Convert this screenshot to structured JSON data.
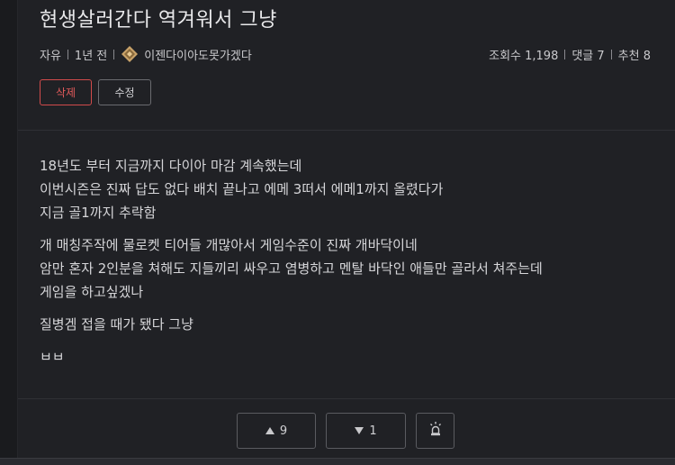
{
  "post": {
    "title": "현생살러간다 역겨워서 그냥",
    "category": "자유",
    "time": "1년 전",
    "author": "이젠다이아도못가겠다",
    "views": "조회수 1,198",
    "comments": "댓글 7",
    "recommends": "추천 8"
  },
  "actions": {
    "delete_label": "삭제",
    "edit_label": "수정"
  },
  "content": {
    "lines": [
      "18년도 부터 지금까지 다이아 마감 계속했는데",
      "이번시즌은 진짜 답도 없다 배치 끝나고 에메 3떠서 에메1까지 올렸다가",
      "지금 골1까지 추락함",
      "개 매칭주작에 물로켓 티어들 개많아서 게임수준이 진짜 개바닥이네",
      "암만 혼자 2인분을 쳐해도 지들끼리 싸우고 염병하고 멘탈 바닥인 애들만 골라서 쳐주는데",
      "게임을 하고싶겠나",
      "질병겜 접을 때가 됐다 그냥",
      "ㅂㅂ"
    ]
  },
  "votes": {
    "up": "9",
    "down": "1"
  },
  "icons": {
    "rank": "rank-emblem-icon",
    "up": "triangle-up-icon",
    "down": "triangle-down-icon",
    "report": "siren-icon"
  },
  "colors": {
    "delete_accent": "#d24b4b",
    "background": "#202125",
    "rank_gold": "#c9a36a"
  }
}
